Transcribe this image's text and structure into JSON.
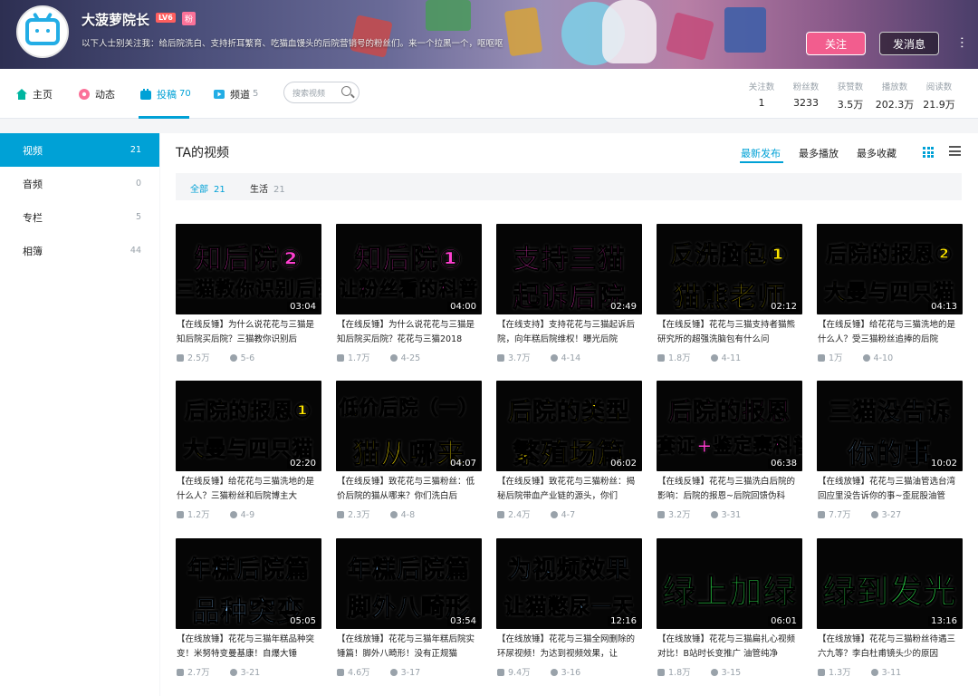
{
  "header": {
    "username": "大菠萝院长",
    "level": "LV6",
    "fan_badge": "粉",
    "signature": "以下人士别关注我：给后院洗白、支持折耳繁育、吃猫血馒头的后院营销号的粉丝们。来一个拉黑一个，呕呕呕",
    "follow_label": "关注",
    "message_label": "发消息",
    "more_label": "⋯"
  },
  "nav": {
    "home": "主页",
    "dynamic": "动态",
    "upload": "投稿",
    "upload_count": "70",
    "channel": "频道",
    "channel_count": "5",
    "search_placeholder": "搜索视频"
  },
  "stats": [
    {
      "label": "关注数",
      "value": "1"
    },
    {
      "label": "粉丝数",
      "value": "3233"
    },
    {
      "label": "获赞数",
      "value": "3.5万"
    },
    {
      "label": "播放数",
      "value": "202.3万"
    },
    {
      "label": "阅读数",
      "value": "21.9万"
    }
  ],
  "sidebar": {
    "items": [
      {
        "label": "视频",
        "count": "21"
      },
      {
        "label": "音频",
        "count": "0"
      },
      {
        "label": "专栏",
        "count": "5"
      },
      {
        "label": "相簿",
        "count": "44"
      }
    ]
  },
  "main": {
    "title": "TA的视频",
    "sort": [
      "最新发布",
      "最多播放",
      "最多收藏"
    ],
    "filters": [
      {
        "label": "全部",
        "count": "21"
      },
      {
        "label": "生活",
        "count": "21"
      }
    ]
  },
  "colors": {
    "accent": "#00a1d6",
    "pink": "#f25d8e"
  },
  "videos": [
    {
      "thumb": [
        "知后院②",
        "三猫教你识别后院"
      ],
      "colors": [
        "#ff3fd0",
        "#ff3fd0"
      ],
      "duration": "03:04",
      "title": "【在线反锤】为什么说花花与三猫是知后院买后院？三猫教你识别后",
      "plays": "2.5万",
      "date": "5-6"
    },
    {
      "thumb": [
        "知后院①",
        "让粉丝看的科普"
      ],
      "colors": [
        "#ff3fd0",
        "#ff3fd0"
      ],
      "duration": "04:00",
      "title": "【在线反锤】为什么说花花与三猫是知后院买后院？花花与三猫2018",
      "plays": "1.7万",
      "date": "4-25"
    },
    {
      "thumb": [
        "支持三猫",
        "起诉后院"
      ],
      "colors": [
        "#ff3fd0",
        "#ff3fd0"
      ],
      "duration": "02:49",
      "title": "【在线支持】支持花花与三猫起诉后院，向年糕后院维权！曝光后院",
      "plays": "3.7万",
      "date": "4-14"
    },
    {
      "thumb": [
        "反洗脑包①",
        "猫熊老师"
      ],
      "colors": [
        "#ffe600",
        "#ffe600"
      ],
      "duration": "02:12",
      "title": "【在线反锤】花花与三猫支持者猫熊研究所的超强洗脑包有什么问",
      "plays": "1.8万",
      "date": "4-11"
    },
    {
      "thumb": [
        "后院的报恩②",
        "大曼与四只猫"
      ],
      "colors": [
        "#ffe600",
        "#ffe600"
      ],
      "duration": "04:13",
      "title": "【在线反锤】给花花与三猫洗地的是什么人？受三猫粉丝追捧的后院",
      "plays": "1万",
      "date": "4-10"
    },
    {
      "thumb": [
        "后院的报恩①",
        "大曼与四只猫"
      ],
      "colors": [
        "#ffe600",
        "#ffe600"
      ],
      "duration": "02:20",
      "title": "【在线反锤】给花花与三猫洗地的是什么人？三猫粉丝和后院博主大",
      "plays": "1.2万",
      "date": "4-9"
    },
    {
      "thumb": [
        "低价后院（一）",
        "猫从哪来"
      ],
      "colors": [
        "#ffe600",
        "#ffe600"
      ],
      "duration": "04:07",
      "title": "【在线反锤】致花花与三猫粉丝：低价后院的猫从哪来？你们洗白后",
      "plays": "2.3万",
      "date": "4-8"
    },
    {
      "thumb": [
        "后院的类型",
        "繁殖场篇"
      ],
      "colors": [
        "#ffe600",
        "#ffe600"
      ],
      "duration": "06:02",
      "title": "【在线反锤】致花花与三猫粉丝：揭秘后院带血产业链的源头，你们",
      "plays": "2.4万",
      "date": "4-7"
    },
    {
      "thumb": [
        "后院的报恩",
        "套证+鉴定赛科普"
      ],
      "colors": [
        "#ff3fd0",
        "#ff3fd0"
      ],
      "duration": "06:38",
      "title": "【在线反锤】花花与三猫洗白后院的影响：后院的报恩~后院回馈伪科",
      "plays": "3.2万",
      "date": "3-31"
    },
    {
      "thumb": [
        "三猫没告诉",
        "你的事"
      ],
      "colors": [
        "#8ec8ff",
        "#8ec8ff"
      ],
      "duration": "10:02",
      "title": "【在线放锤】花花与三猫油管选台湾回应里没告诉你的事~歪屁股油管",
      "plays": "7.7万",
      "date": "3-27"
    },
    {
      "thumb": [
        "年糕后院篇",
        "品种突变"
      ],
      "colors": [
        "#8ec8ff",
        "#8ec8ff"
      ],
      "duration": "05:05",
      "title": "【在线放锤】花花与三猫年糕品种突变！米努特变曼基康！自爆大锤",
      "plays": "2.7万",
      "date": "3-21"
    },
    {
      "thumb": [
        "年糕后院篇",
        "脚外八畸形"
      ],
      "colors": [
        "#8ec8ff",
        "#8ec8ff"
      ],
      "duration": "03:54",
      "title": "【在线放锤】花花与三猫年糕后院实锤篇！脚外八畸形！没有正规猫",
      "plays": "4.6万",
      "date": "3-17"
    },
    {
      "thumb": [
        "为视频效果",
        "让猫憋尿一天"
      ],
      "colors": [
        "#8ec8ff",
        "#8ec8ff"
      ],
      "duration": "12:16",
      "title": "【在线放锤】花花与三猫全网删除的环尿视频！为达到视频效果，让",
      "plays": "9.4万",
      "date": "3-16"
    },
    {
      "thumb": [
        "绿上加绿",
        ""
      ],
      "colors": [
        "#2bd64a",
        "#2bd64a"
      ],
      "duration": "06:01",
      "title": "【在线放锤】花花与三猫扁扎心视频对比！B站时长变推广 油管纯净",
      "plays": "1.8万",
      "date": "3-15"
    },
    {
      "thumb": [
        "绿到发光",
        ""
      ],
      "colors": [
        "#2bd64a",
        "#2bd64a"
      ],
      "duration": "13:16",
      "title": "【在线放锤】花花与三猫粉丝待遇三六九等？李白杜甫镜头少的原因",
      "plays": "1.3万",
      "date": "3-11"
    }
  ]
}
